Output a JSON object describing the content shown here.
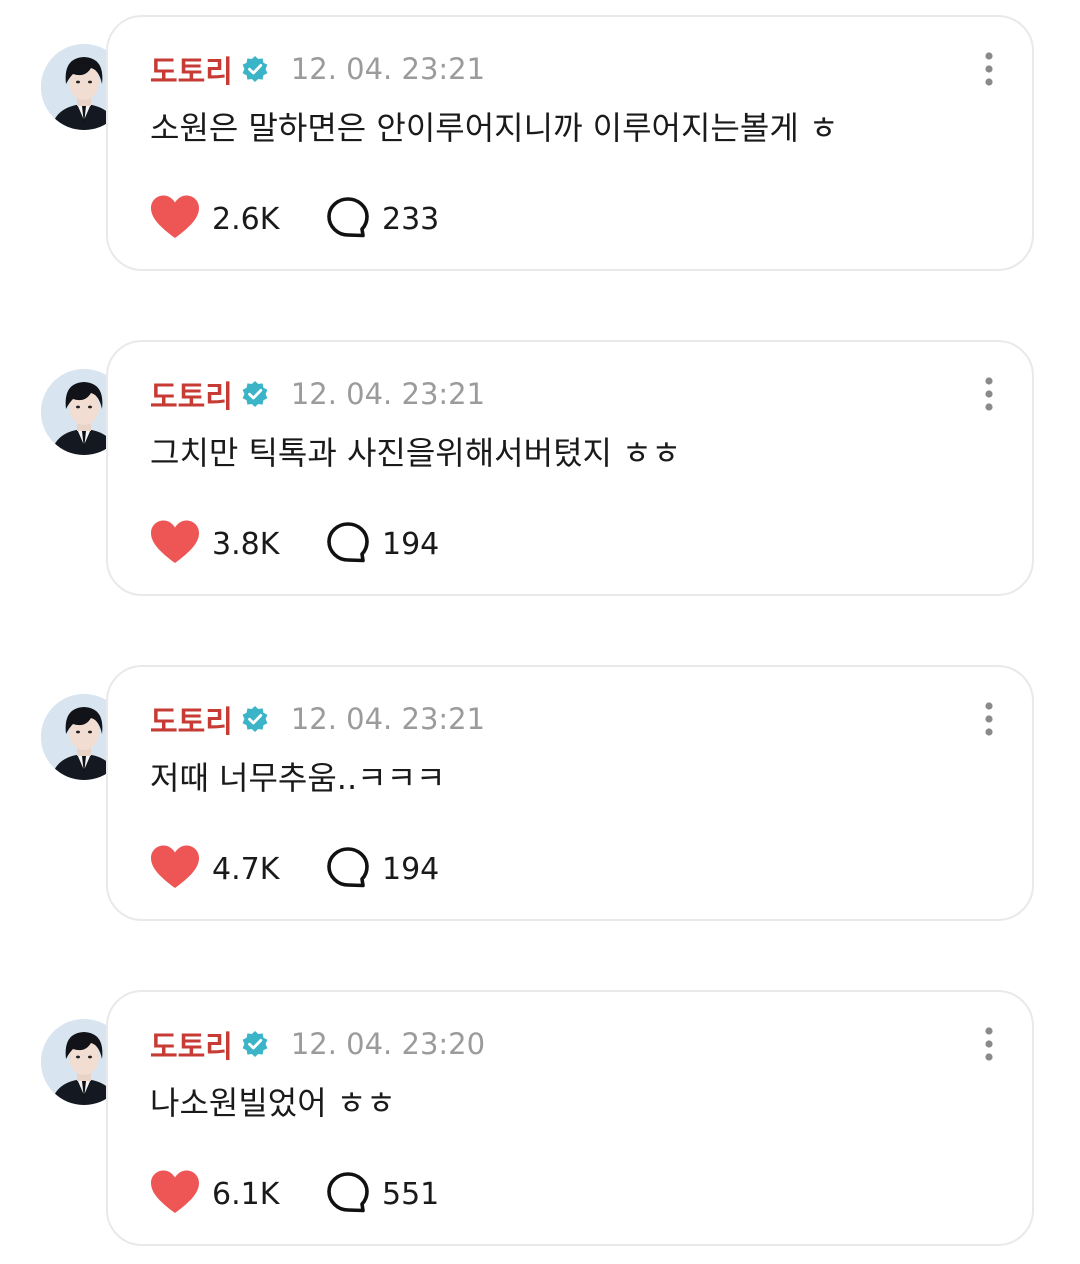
{
  "colors": {
    "author": "#c73b35",
    "heart": "#ee5555",
    "verified": "#3cb4c8",
    "timestamp": "#9b9b9b",
    "border": "#e9e9e9"
  },
  "icons": {
    "like": "heart-icon",
    "comment": "comment-bubble-icon",
    "verified": "verified-badge-icon",
    "more": "more-options-icon"
  },
  "posts": [
    {
      "author": "도토리",
      "timestamp": "12. 04. 23:21",
      "message": "소원은 말하면은 안이루어지니까 이루어지는볼게 ㅎ",
      "likes": "2.6K",
      "comments": "233"
    },
    {
      "author": "도토리",
      "timestamp": "12. 04. 23:21",
      "message": "그치만 틱톡과 사진을위해서버텼지 ㅎㅎ",
      "likes": "3.8K",
      "comments": "194"
    },
    {
      "author": "도토리",
      "timestamp": "12. 04. 23:21",
      "message": "저때 너무추움..ㅋㅋㅋ",
      "likes": "4.7K",
      "comments": "194"
    },
    {
      "author": "도토리",
      "timestamp": "12. 04. 23:20",
      "message": "나소원빌었어 ㅎㅎ",
      "likes": "6.1K",
      "comments": "551"
    }
  ]
}
